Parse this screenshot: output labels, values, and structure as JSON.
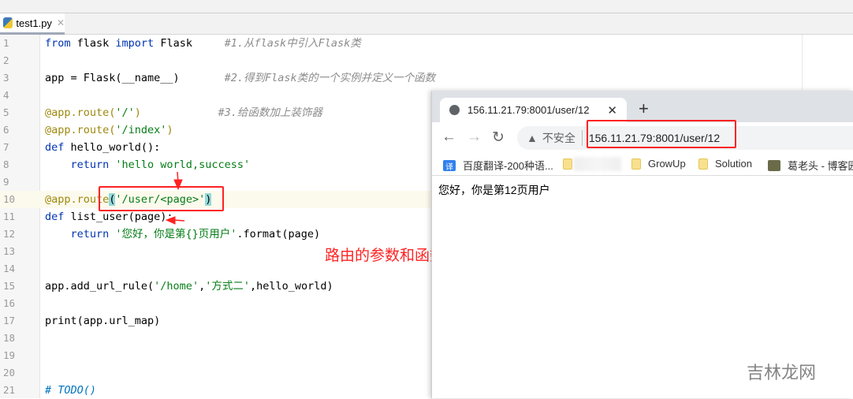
{
  "editor": {
    "file_tab": "test1.py",
    "close": "✕",
    "lines": [
      [
        {
          "t": "from ",
          "c": "kw"
        },
        {
          "t": "flask ",
          "c": "fn"
        },
        {
          "t": "import ",
          "c": "kw"
        },
        {
          "t": "Flask     ",
          "c": "fn"
        },
        {
          "t": "#1.从flask中引入Flask类",
          "c": "cm"
        }
      ],
      [],
      [
        {
          "t": "app = Flask(__name__)       ",
          "c": "fn"
        },
        {
          "t": "#2.得到Flask类的一个实例并定义一个函数",
          "c": "cm"
        }
      ],
      [],
      [
        {
          "t": "@app.route(",
          "c": "dec"
        },
        {
          "t": "'/'",
          "c": "str"
        },
        {
          "t": ")            ",
          "c": "dec"
        },
        {
          "t": "#3.给函数加上装饰器",
          "c": "cm"
        }
      ],
      [
        {
          "t": "@app.route(",
          "c": "dec"
        },
        {
          "t": "'/index'",
          "c": "str"
        },
        {
          "t": ")",
          "c": "dec"
        }
      ],
      [
        {
          "t": "def ",
          "c": "kw"
        },
        {
          "t": "hello_world():",
          "c": "fn"
        }
      ],
      [
        {
          "t": "    return ",
          "c": "kw"
        },
        {
          "t": "'hello world,success'",
          "c": "str"
        }
      ],
      [],
      [
        {
          "t": "@app.route",
          "c": "dec"
        },
        {
          "t": "(",
          "c": "hl"
        },
        {
          "t": "'/user/<page>'",
          "c": "str"
        },
        {
          "t": ")",
          "c": "hl"
        }
      ],
      [
        {
          "t": "def ",
          "c": "kw"
        },
        {
          "t": "list_user(page):",
          "c": "fn"
        }
      ],
      [
        {
          "t": "    return ",
          "c": "kw"
        },
        {
          "t": "'您好，你是第{}页用户'",
          "c": "str"
        },
        {
          "t": ".format(page)",
          "c": "fn"
        }
      ],
      [],
      [],
      [
        {
          "t": "app.add_url_rule(",
          "c": "fn"
        },
        {
          "t": "'/home'",
          "c": "str"
        },
        {
          "t": ",",
          "c": "fn"
        },
        {
          "t": "'方式二'",
          "c": "str"
        },
        {
          "t": ",hello_world)",
          "c": "fn"
        }
      ],
      [],
      [
        {
          "t": "print(app.url_map)",
          "c": "fn"
        }
      ],
      [],
      [],
      [],
      [
        {
          "t": "# TODO()",
          "c": "todo"
        }
      ]
    ]
  },
  "browser": {
    "tab_title": "156.11.21.79:8001/user/12",
    "close": "✕",
    "new_tab": "+",
    "back": "←",
    "forward": "→",
    "reload": "↻",
    "warning_icon": "▲",
    "insecure": "不安全",
    "url": "156.11.21.79:8001/user/12",
    "bookmarks": [
      "百度翻译-200种语...",
      "GrowUp",
      "Solution",
      "葛老头 - 博客园"
    ],
    "bookmark_icon_text": "译",
    "content": "您好，你是第12页用户"
  },
  "annotation": "路由的参数和函数的参数命名要一致",
  "watermark": "吉林龙网",
  "colors": {
    "annotation": "#ff2222",
    "current_line": "#fcfaed"
  }
}
